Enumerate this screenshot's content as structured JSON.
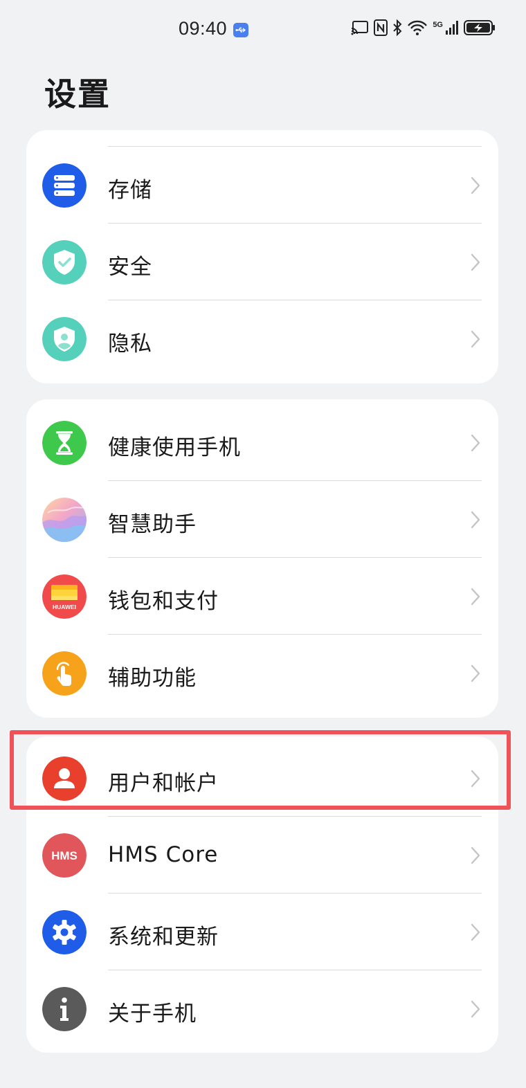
{
  "status_bar": {
    "time": "09:40",
    "network_label": "5G",
    "icons": [
      "usb-notification-icon",
      "screen-cast-icon",
      "nfc-icon",
      "bluetooth-icon",
      "wifi-icon",
      "cellular-signal-icon",
      "battery-charging-icon"
    ]
  },
  "page": {
    "title": "设置"
  },
  "groups": [
    {
      "items": [
        {
          "label": "存储",
          "icon": "storage-icon",
          "color": "#1f5ce8"
        },
        {
          "label": "安全",
          "icon": "security-shield-icon",
          "color": "#55d0bb"
        },
        {
          "label": "隐私",
          "icon": "privacy-shield-icon",
          "color": "#55d0bb"
        }
      ]
    },
    {
      "items": [
        {
          "label": "健康使用手机",
          "icon": "hourglass-icon",
          "color": "#3fc94c"
        },
        {
          "label": "智慧助手",
          "icon": "smart-assistant-icon",
          "color": "#e9a7d0"
        },
        {
          "label": "钱包和支付",
          "icon": "wallet-icon",
          "color": "#f04a4a",
          "badge_text": "HUAWEI"
        },
        {
          "label": "辅助功能",
          "icon": "accessibility-hand-icon",
          "color": "#f7a21b"
        }
      ]
    },
    {
      "items": [
        {
          "label": "用户和帐户",
          "icon": "user-icon",
          "color": "#e8402d",
          "highlighted": true
        },
        {
          "label": "HMS Core",
          "icon": "hms-core-icon",
          "color": "#e0565a",
          "badge_text": "HMS"
        },
        {
          "label": "系统和更新",
          "icon": "gear-icon",
          "color": "#1f5ce8"
        },
        {
          "label": "关于手机",
          "icon": "info-icon",
          "color": "#5a5a5a"
        }
      ]
    }
  ],
  "colors": {
    "background": "#f1f2f4",
    "card": "#ffffff",
    "highlight": "#ef5258",
    "chevron": "#c4c4c4"
  }
}
